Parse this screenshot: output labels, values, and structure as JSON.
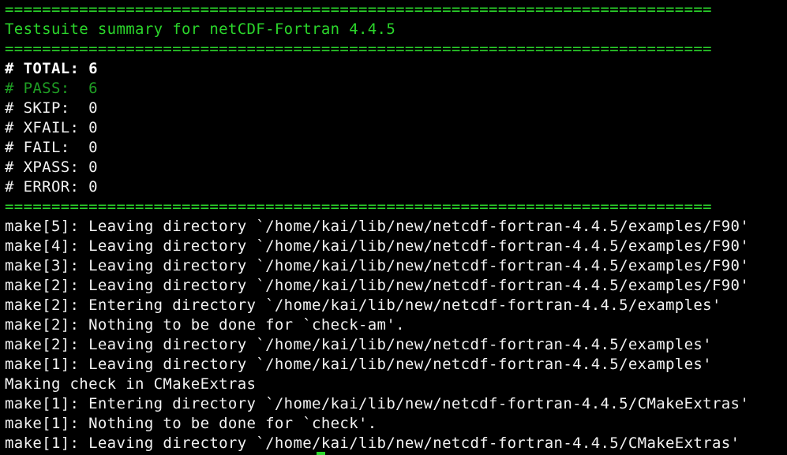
{
  "terminal": {
    "colors": {
      "background": "#000000",
      "text": "#f2f2f2",
      "green": "#2bd52b",
      "dim_green": "#1f9e24"
    },
    "lines": [
      "============================================================================",
      "Testsuite summary for netCDF-Fortran 4.4.5",
      "============================================================================",
      "# TOTAL: 6",
      "# PASS:  6",
      "# SKIP:  0",
      "# XFAIL: 0",
      "# FAIL:  0",
      "# XPASS: 0",
      "# ERROR: 0",
      "============================================================================",
      "make[5]: Leaving directory `/home/kai/lib/new/netcdf-fortran-4.4.5/examples/F90'",
      "make[4]: Leaving directory `/home/kai/lib/new/netcdf-fortran-4.4.5/examples/F90'",
      "make[3]: Leaving directory `/home/kai/lib/new/netcdf-fortran-4.4.5/examples/F90'",
      "make[2]: Leaving directory `/home/kai/lib/new/netcdf-fortran-4.4.5/examples/F90'",
      "make[2]: Entering directory `/home/kai/lib/new/netcdf-fortran-4.4.5/examples'",
      "make[2]: Nothing to be done for `check-am'.",
      "make[2]: Leaving directory `/home/kai/lib/new/netcdf-fortran-4.4.5/examples'",
      "make[1]: Leaving directory `/home/kai/lib/new/netcdf-fortran-4.4.5/examples'",
      "Making check in CMakeExtras",
      "make[1]: Entering directory `/home/kai/lib/new/netcdf-fortran-4.4.5/CMakeExtras'",
      "make[1]: Nothing to be done for `check'.",
      "make[1]: Leaving directory `/home/kai/lib/new/netcdf-fortran-4.4.5/CMakeExtras'"
    ]
  }
}
